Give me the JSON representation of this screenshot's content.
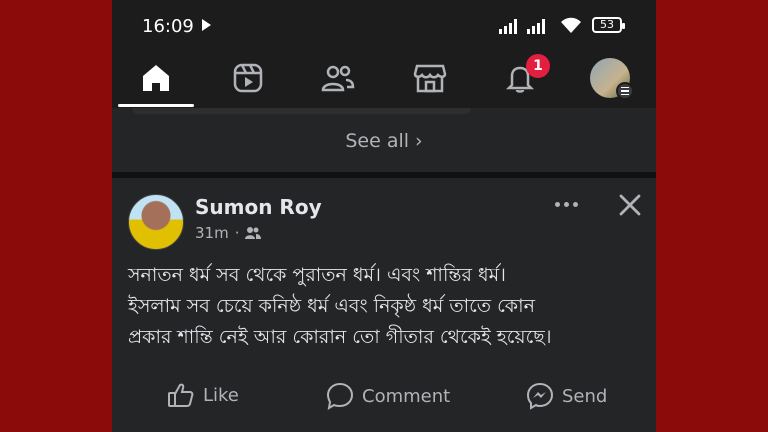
{
  "status": {
    "time": "16:09",
    "battery": "53"
  },
  "nav": {
    "tabs": [
      {
        "name": "home",
        "icon": "home-icon"
      },
      {
        "name": "reels",
        "icon": "reels-icon"
      },
      {
        "name": "friends",
        "icon": "friends-icon"
      },
      {
        "name": "marketplace",
        "icon": "marketplace-icon"
      },
      {
        "name": "notifications",
        "icon": "bell-icon"
      },
      {
        "name": "profile-menu",
        "icon": "avatar"
      }
    ],
    "notification_count": "1"
  },
  "see_all": {
    "label": "See all",
    "chevron": "›"
  },
  "post": {
    "author": "Sumon Roy",
    "time": "31m",
    "separator": "·",
    "privacy_icon": "friends-icon",
    "text_lines": [
      "সনাতন ধর্ম সব থেকে পুরাতন ধর্ম। এবং শান্তির ধর্ম।",
      "ইসলাম সব চেয়ে কনিষ্ঠ ধর্ম এবং নিকৃষ্ঠ ধর্ম  তাতে কোন",
      "প্রকার শান্তি নেই আর কোরান তো গীতার থেকেই হয়েছে।"
    ],
    "actions": {
      "like": "Like",
      "comment": "Comment",
      "send": "Send"
    }
  },
  "colors": {
    "background": "#8b0a0a",
    "surface": "#242526",
    "badge": "#e41e3f"
  }
}
